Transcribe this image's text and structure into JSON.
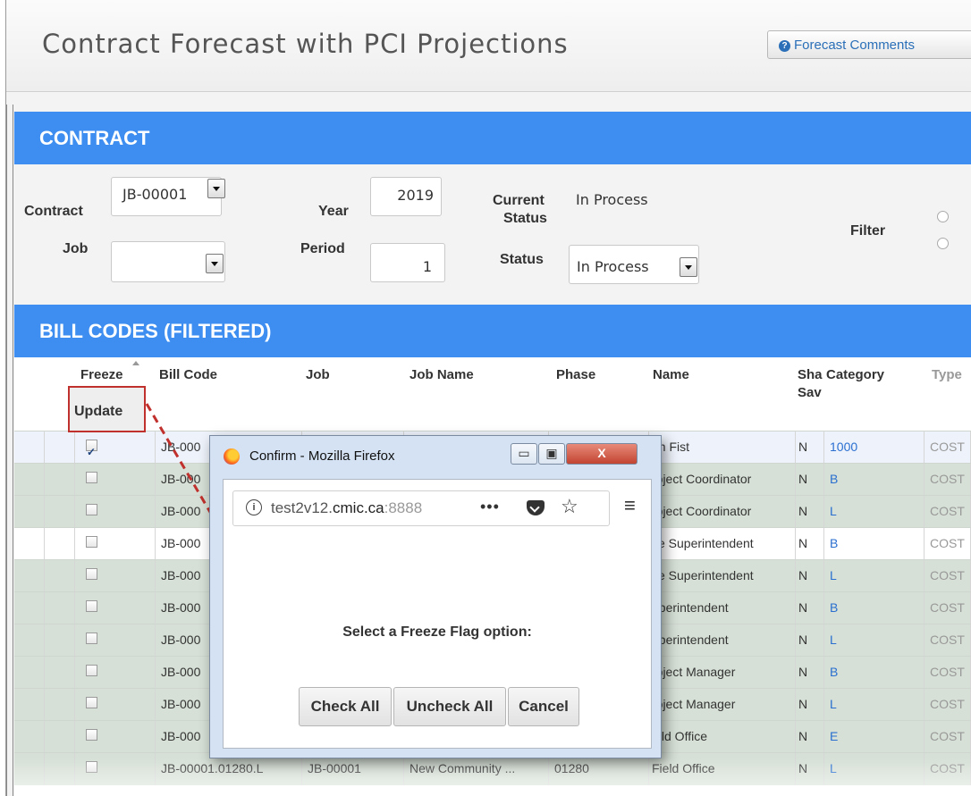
{
  "page": {
    "title": "Contract Forecast with PCI Projections",
    "forecast_comments_button": "Forecast Comments"
  },
  "contract_section": {
    "header": "CONTRACT",
    "contract_label": "Contract",
    "contract_value": "JB-00001",
    "job_label": "Job",
    "job_value": "",
    "year_label": "Year",
    "year_value": "2019",
    "period_label": "Period",
    "period_value": "1",
    "current_status_label_1": "Current",
    "current_status_label_2": "Status",
    "current_status_value": "In Process",
    "status_label": "Status",
    "status_value": "In Process",
    "filter_label": "Filter"
  },
  "bill_codes": {
    "header": "BILL CODES (FILTERED)",
    "columns": {
      "freeze": "Freeze",
      "update": "Update",
      "bill_code": "Bill Code",
      "job": "Job",
      "job_name": "Job Name",
      "phase": "Phase",
      "name": "Name",
      "share_1": "Sha",
      "share_2": "Sav",
      "category": "Category",
      "type": "Type"
    },
    "rows": [
      {
        "checked": true,
        "bill_code": "JB-000",
        "name": "on Fist",
        "share": "N",
        "category": "1000",
        "type": "COST"
      },
      {
        "checked": false,
        "bill_code": "JB-000",
        "name": "roject Coordinator",
        "share": "N",
        "category": "B",
        "type": "COST"
      },
      {
        "checked": false,
        "bill_code": "JB-000",
        "name": "roject Coordinator",
        "share": "N",
        "category": "L",
        "type": "COST"
      },
      {
        "checked": false,
        "bill_code": "JB-000",
        "name": "ite Superintendent",
        "share": "N",
        "category": "B",
        "type": "COST"
      },
      {
        "checked": false,
        "bill_code": "JB-000",
        "name": "ite Superintendent",
        "share": "N",
        "category": "L",
        "type": "COST"
      },
      {
        "checked": false,
        "bill_code": "JB-000",
        "name": "uperintendent",
        "share": "N",
        "category": "B",
        "type": "COST"
      },
      {
        "checked": false,
        "bill_code": "JB-000",
        "name": "uperintendent",
        "share": "N",
        "category": "L",
        "type": "COST"
      },
      {
        "checked": false,
        "bill_code": "JB-000",
        "name": "roject Manager",
        "share": "N",
        "category": "B",
        "type": "COST"
      },
      {
        "checked": false,
        "bill_code": "JB-000",
        "name": "roject Manager",
        "share": "N",
        "category": "L",
        "type": "COST"
      },
      {
        "checked": false,
        "bill_code": "JB-000",
        "name": "ield Office",
        "share": "N",
        "category": "E",
        "type": "COST"
      },
      {
        "checked": false,
        "bill_code": "JB-00001.01280.L",
        "job": "JB-00001",
        "job_name": "New Community ...",
        "phase": "01280",
        "name": "Field Office",
        "share": "N",
        "category": "L",
        "type": "COST"
      }
    ]
  },
  "dialog": {
    "title": "Confirm - Mozilla Firefox",
    "url_plain": "test2v12.",
    "url_domain": "cmic.ca",
    "url_port": ":8888",
    "url_dots": "•••",
    "message": "Select a Freeze Flag option:",
    "check_all": "Check All",
    "uncheck_all": "Uncheck All",
    "cancel": "Cancel"
  },
  "colors": {
    "section_header_bg": "#3d8ef0",
    "highlight_red": "#c0302c",
    "category_link": "#2a6fd0",
    "row_green": "#d6e0d6"
  }
}
